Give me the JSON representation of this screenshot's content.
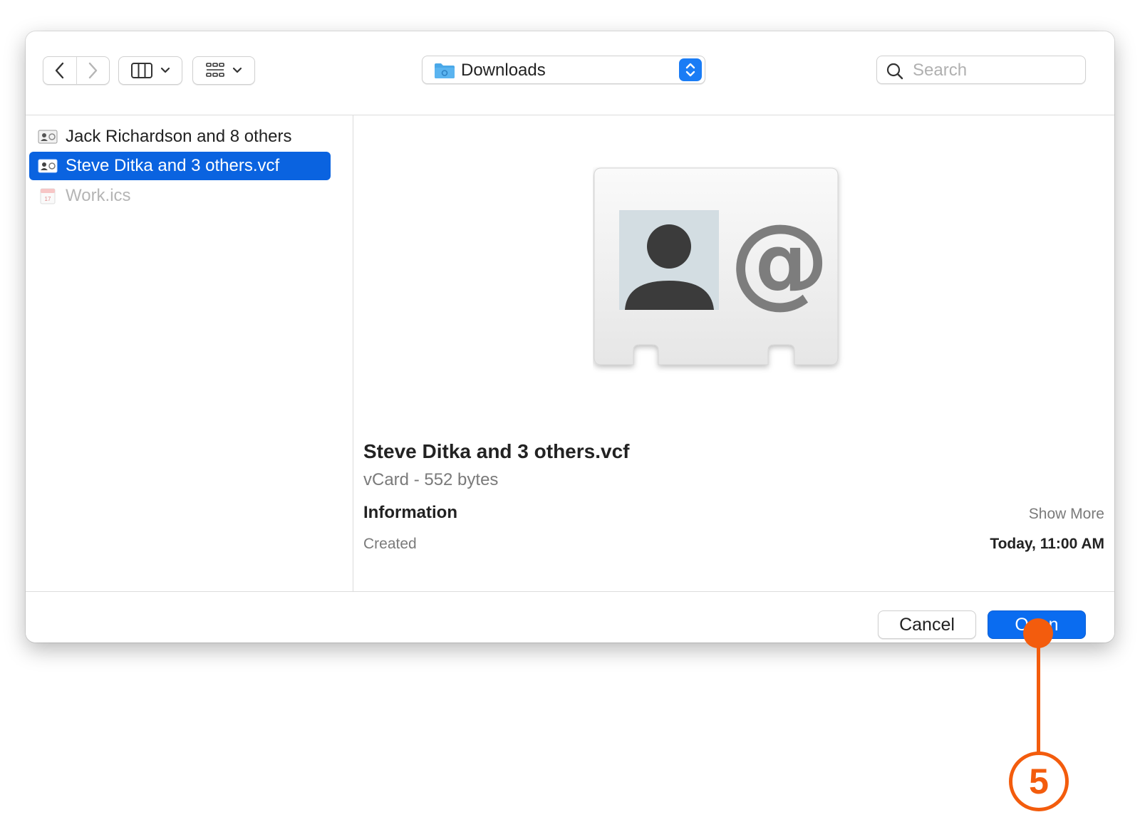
{
  "location": {
    "folder": "Downloads"
  },
  "search": {
    "placeholder": "Search"
  },
  "files": [
    {
      "name": "Jack Richardson and 8 others",
      "icon": "vcard-icon",
      "state": "normal"
    },
    {
      "name": "Steve Ditka and 3 others.vcf",
      "icon": "vcard-icon",
      "state": "selected"
    },
    {
      "name": "Work.ics",
      "icon": "calendar-icon",
      "state": "disabled"
    }
  ],
  "preview": {
    "title": "Steve Ditka and 3 others.vcf",
    "subtitle": "vCard - 552 bytes",
    "info_heading": "Information",
    "show_more": "Show More",
    "created_label": "Created",
    "created_value": "Today, 11:00 AM"
  },
  "buttons": {
    "cancel": "Cancel",
    "open": "Open"
  },
  "callout": {
    "step": "5"
  },
  "colors": {
    "accent": "#0a63e0",
    "callout": "#f35c0d"
  }
}
